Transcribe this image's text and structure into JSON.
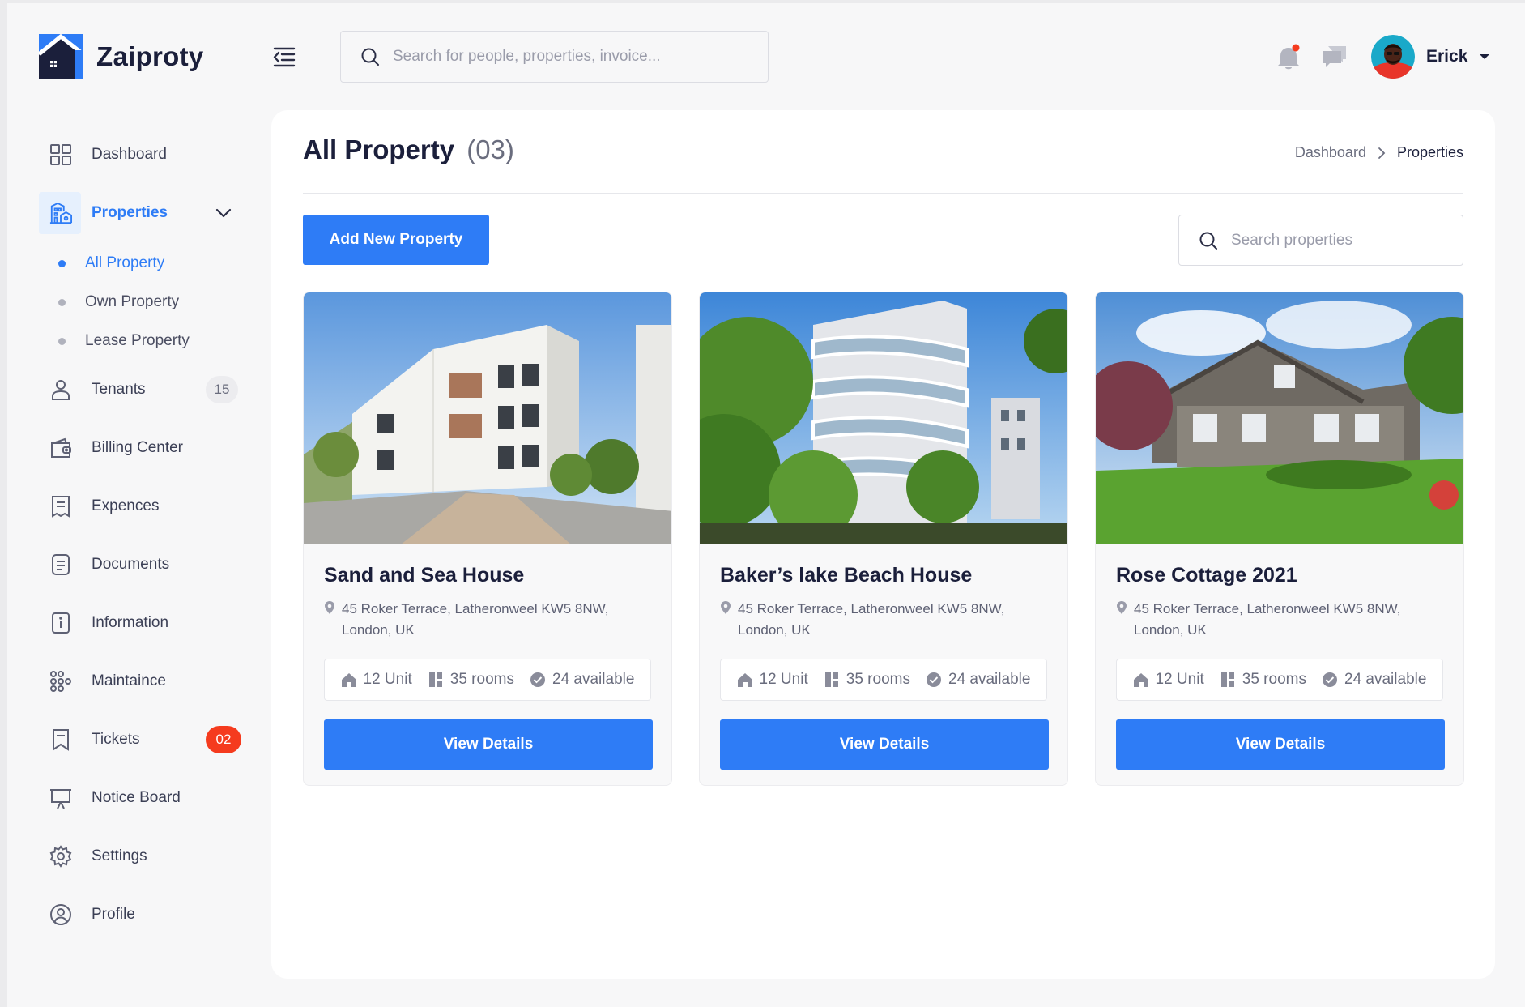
{
  "app": {
    "name": "Zaiproty"
  },
  "header": {
    "search_placeholder": "Search for people, properties, invoice...",
    "user_name": "Erick",
    "has_notification": true
  },
  "sidebar": {
    "items": [
      {
        "label": "Dashboard",
        "icon": "dashboard-icon"
      },
      {
        "label": "Properties",
        "icon": "building-icon",
        "active": true,
        "expanded": true,
        "children": [
          {
            "label": "All Property",
            "active": true
          },
          {
            "label": "Own Property"
          },
          {
            "label": "Lease Property"
          }
        ]
      },
      {
        "label": "Tenants",
        "icon": "user-icon",
        "badge": "15"
      },
      {
        "label": "Billing Center",
        "icon": "wallet-icon"
      },
      {
        "label": "Expences",
        "icon": "receipt-icon"
      },
      {
        "label": "Documents",
        "icon": "document-icon"
      },
      {
        "label": "Information",
        "icon": "info-icon"
      },
      {
        "label": "Maintaince",
        "icon": "network-icon"
      },
      {
        "label": "Tickets",
        "icon": "ticket-icon",
        "badge": "02"
      },
      {
        "label": "Notice Board",
        "icon": "board-icon"
      },
      {
        "label": "Settings",
        "icon": "gear-icon"
      },
      {
        "label": "Profile",
        "icon": "profile-icon"
      }
    ]
  },
  "main": {
    "title": "All Property",
    "count": "(03)",
    "breadcrumb": {
      "link": "Dashboard",
      "current": "Properties"
    },
    "add_button": "Add New Property",
    "search_placeholder": "Search properties",
    "cards": [
      {
        "title": "Sand and Sea House",
        "address": "45 Roker Terrace, Latheronweel KW5 8NW, London, UK",
        "units": "12 Unit",
        "rooms": "35 rooms",
        "available": "24 available",
        "button": "View Details",
        "image": "white-apartment-building-photo"
      },
      {
        "title": "Baker’s lake Beach House",
        "address": "45 Roker Terrace, Latheronweel KW5 8NW, London, UK",
        "units": "12 Unit",
        "rooms": "35 rooms",
        "available": "24 available",
        "button": "View Details",
        "image": "balcony-apartment-trees-photo"
      },
      {
        "title": "Rose Cottage 2021",
        "address": "45 Roker Terrace, Latheronweel KW5 8NW, London, UK",
        "units": "12 Unit",
        "rooms": "35 rooms",
        "available": "24 available",
        "button": "View Details",
        "image": "suburban-house-lawn-photo"
      }
    ]
  },
  "colors": {
    "accent": "#2e7cf6",
    "accent_light": "#e6f0fd",
    "badge_red": "#f53b1e",
    "text_dark": "#1b1f3b",
    "background": "#f7f7f8"
  }
}
